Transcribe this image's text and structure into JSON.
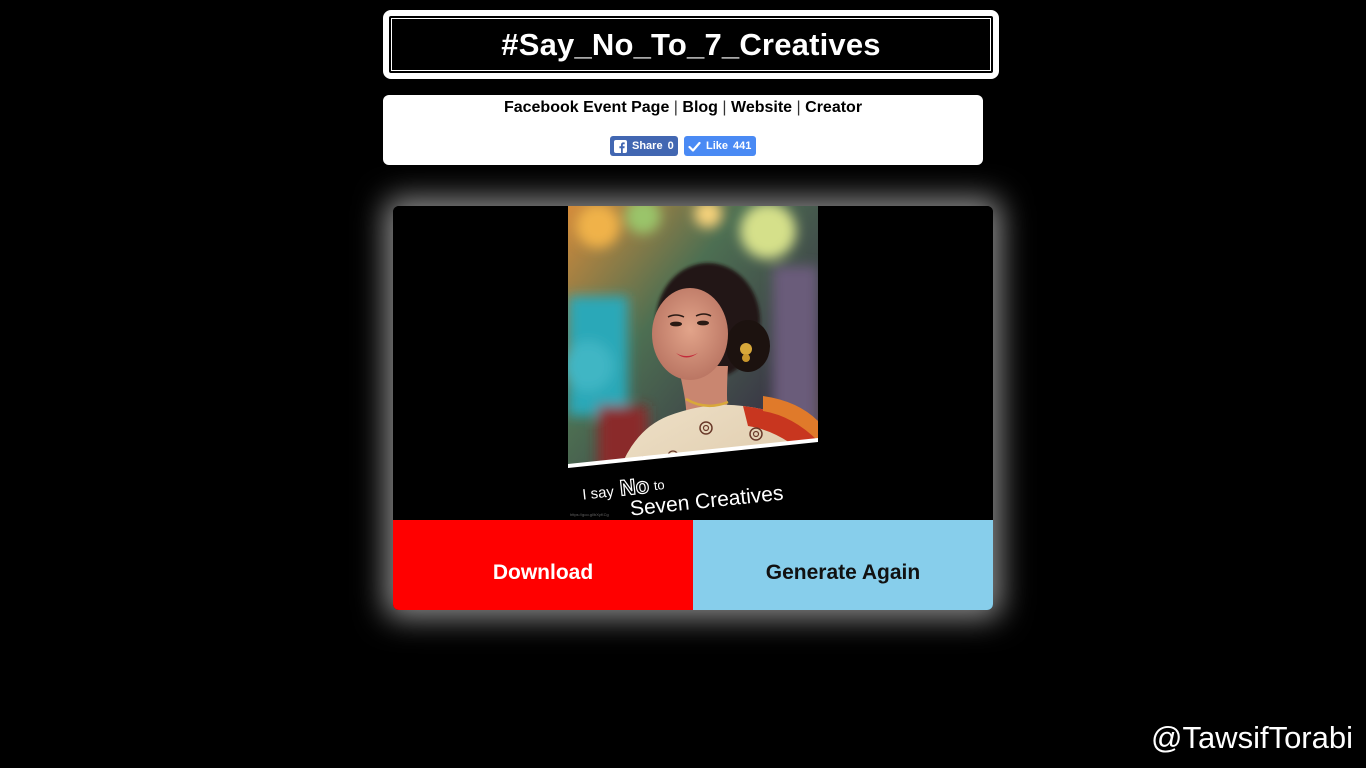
{
  "header": {
    "title": "#Say_No_To_7_Creatives"
  },
  "links": {
    "items": [
      "Facebook Event Page",
      "Blog",
      "Website",
      "Creator"
    ],
    "separator": "|"
  },
  "social": {
    "share": {
      "label": "Share",
      "count": "0",
      "color": "#4267b2"
    },
    "like": {
      "label": "Like",
      "count": "441",
      "color": "#4a8af4"
    }
  },
  "preview": {
    "caption_prefix": "I say",
    "caption_no": "No",
    "caption_to": "to",
    "caption_main": "Seven Creatives",
    "url_small": "https://goo.gl/bXyKCg"
  },
  "actions": {
    "download_label": "Download",
    "download_color": "#ff0000",
    "generate_label": "Generate Again",
    "generate_color": "#87ceeb"
  },
  "footer": {
    "handle": "@TawsifTorabi"
  }
}
